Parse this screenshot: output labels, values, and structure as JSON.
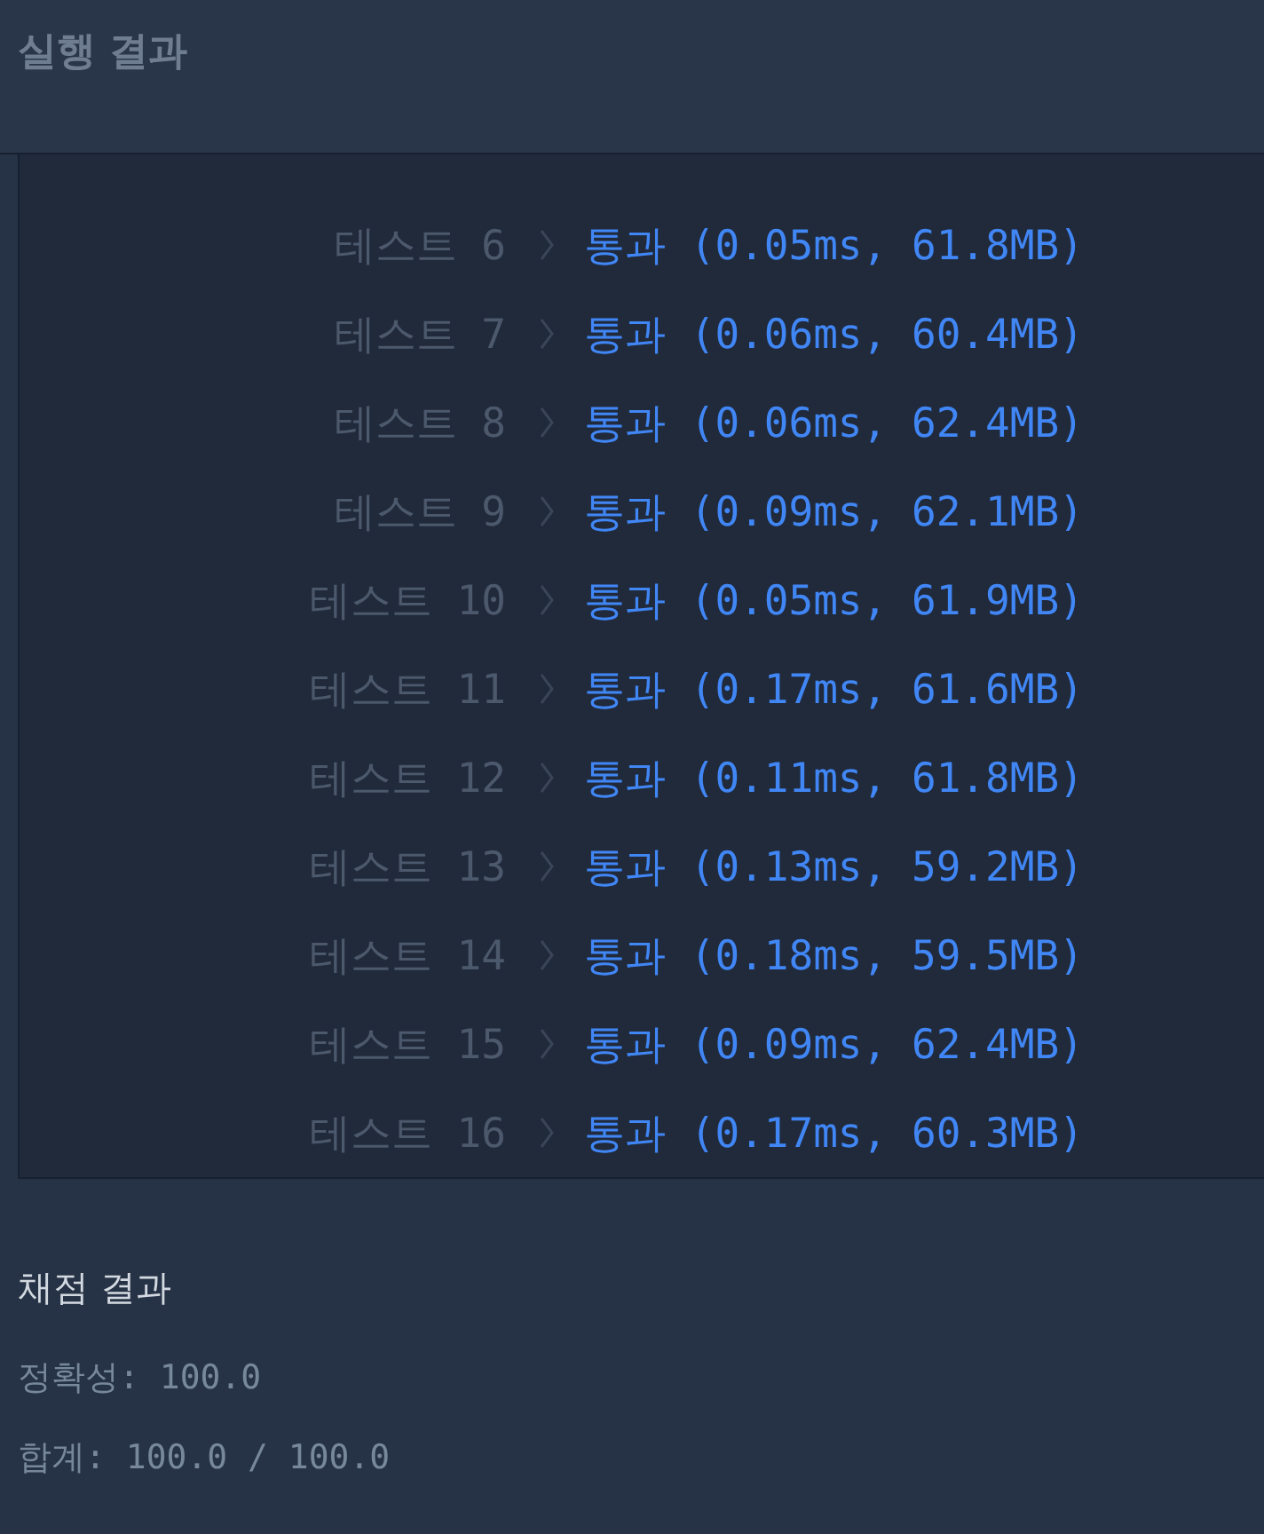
{
  "header": {
    "title": "실행 결과"
  },
  "tests": [
    {
      "label": "테스트 6",
      "result": "통과",
      "detail": "(0.05ms, 61.8MB)"
    },
    {
      "label": "테스트 7",
      "result": "통과",
      "detail": "(0.06ms, 60.4MB)"
    },
    {
      "label": "테스트 8",
      "result": "통과",
      "detail": "(0.06ms, 62.4MB)"
    },
    {
      "label": "테스트 9",
      "result": "통과",
      "detail": "(0.09ms, 62.1MB)"
    },
    {
      "label": "테스트 10",
      "result": "통과",
      "detail": "(0.05ms, 61.9MB)"
    },
    {
      "label": "테스트 11",
      "result": "통과",
      "detail": "(0.17ms, 61.6MB)"
    },
    {
      "label": "테스트 12",
      "result": "통과",
      "detail": "(0.11ms, 61.8MB)"
    },
    {
      "label": "테스트 13",
      "result": "통과",
      "detail": "(0.13ms, 59.2MB)"
    },
    {
      "label": "테스트 14",
      "result": "통과",
      "detail": "(0.18ms, 59.5MB)"
    },
    {
      "label": "테스트 15",
      "result": "통과",
      "detail": "(0.09ms, 62.4MB)"
    },
    {
      "label": "테스트 16",
      "result": "통과",
      "detail": "(0.17ms, 60.3MB)"
    }
  ],
  "grading": {
    "title": "채점 결과",
    "lines": [
      "정확성: 100.0",
      "합계: 100.0 / 100.0"
    ]
  }
}
